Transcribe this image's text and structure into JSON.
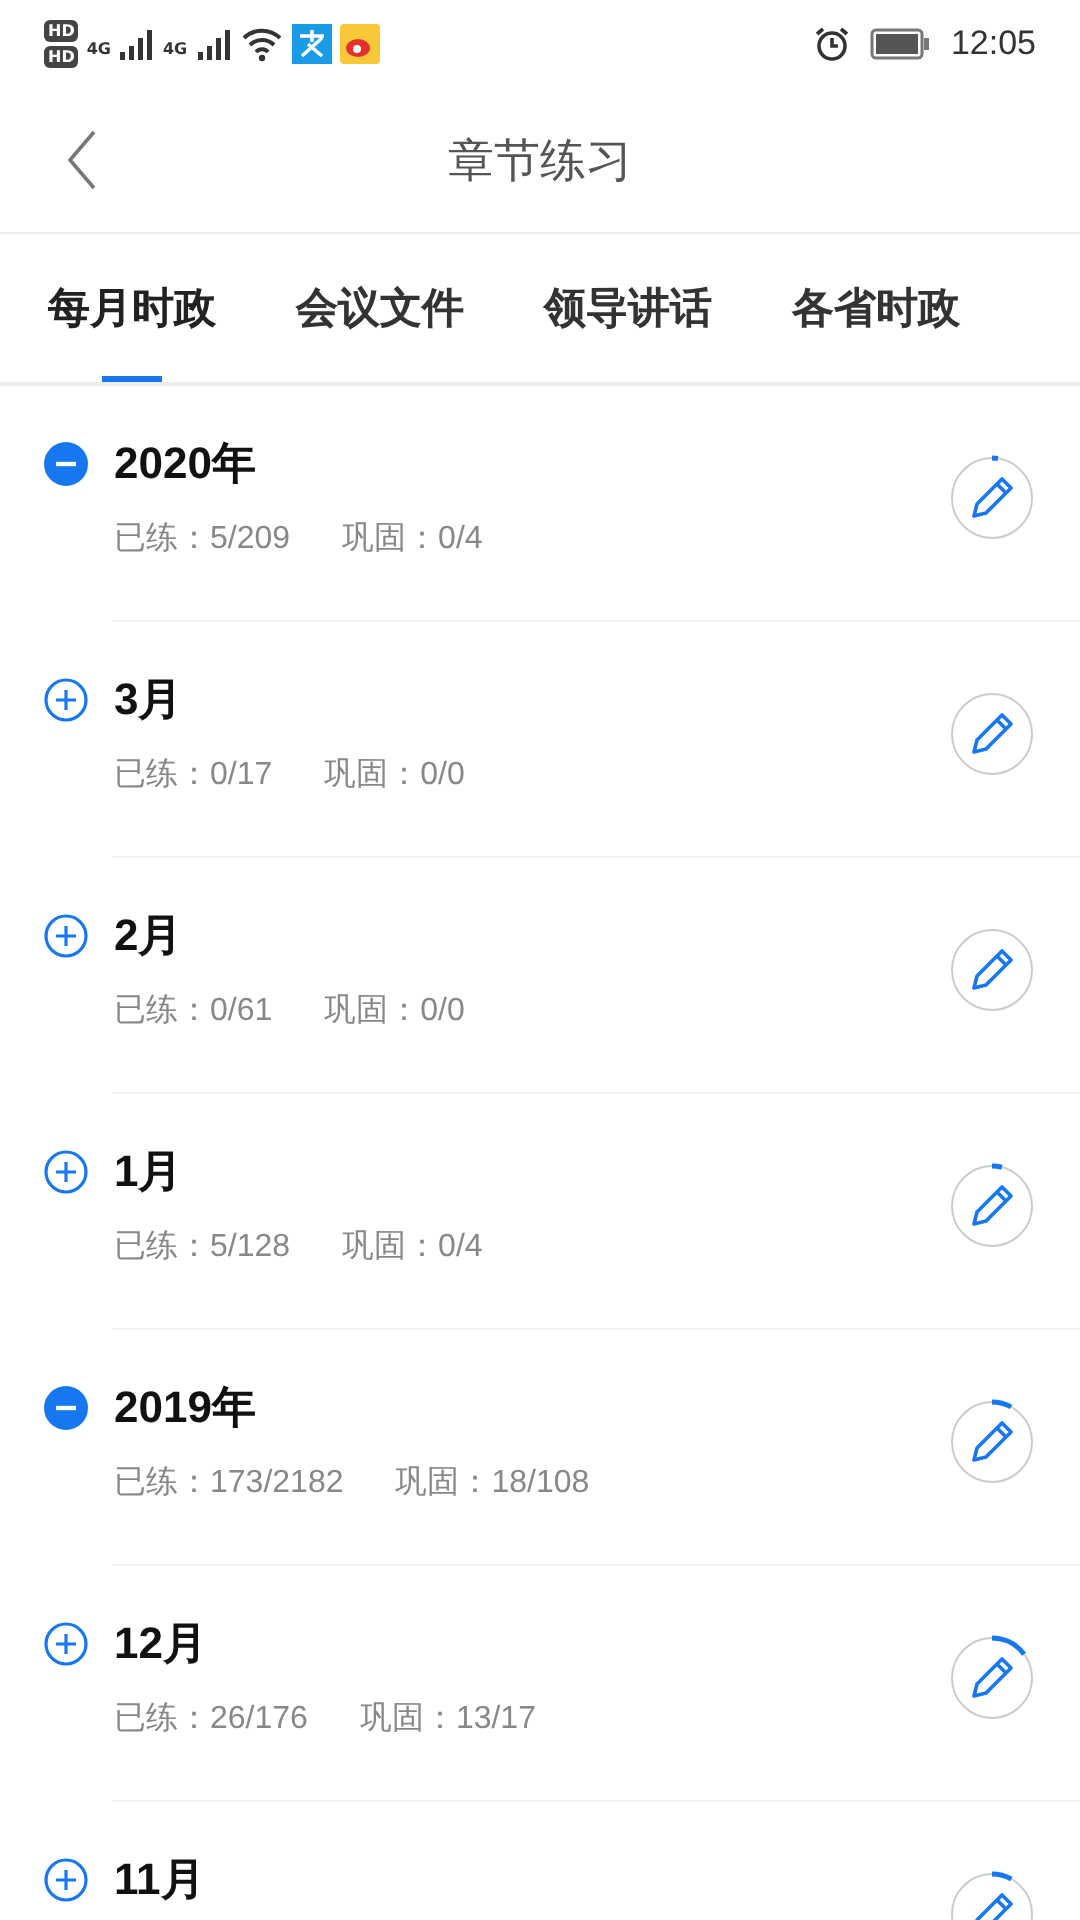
{
  "status_bar": {
    "sim_labels": [
      "HD",
      "HD"
    ],
    "network_labels": [
      "4G",
      "4G"
    ],
    "time": "12:05"
  },
  "header": {
    "title": "章节练习"
  },
  "tabs": [
    {
      "label": "每月时政",
      "selected": true
    },
    {
      "label": "会议文件",
      "selected": false
    },
    {
      "label": "领导讲话",
      "selected": false
    },
    {
      "label": "各省时政",
      "selected": false
    }
  ],
  "chapters": [
    {
      "title": "2020年",
      "expanded": true,
      "practiced": "已练：5/209",
      "review": "巩固：0/4",
      "level": 0.024
    },
    {
      "title": "3月",
      "expanded": false,
      "practiced": "已练：0/17",
      "review": "巩固：0/0"
    },
    {
      "title": "2月",
      "expanded": false,
      "practiced": "已练：0/61",
      "review": "巩固：0/0"
    },
    {
      "title": "1月",
      "expanded": false,
      "practiced": "已练：5/128",
      "review": "巩固：0/4",
      "level": 0.04
    },
    {
      "title": "2019年",
      "expanded": true,
      "practiced": "已练：173/2182",
      "review": "巩固：18/108",
      "level": 0.079
    },
    {
      "title": "12月",
      "expanded": false,
      "practiced": "已练：26/176",
      "review": "巩固：13/17",
      "level": 0.148
    },
    {
      "title": "11月",
      "expanded": false,
      "level": 0.08
    }
  ]
}
